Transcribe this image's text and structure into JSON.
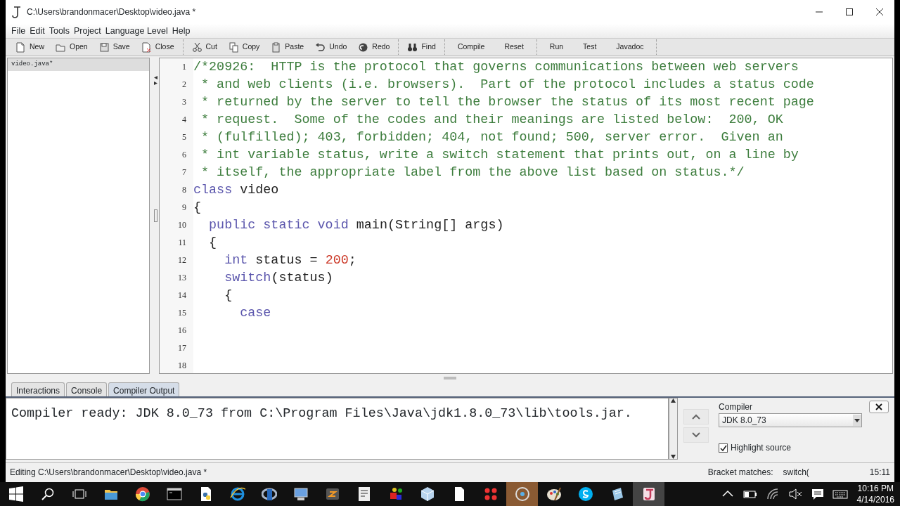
{
  "window": {
    "title": "C:\\Users\\brandonmacer\\Desktop\\video.java *"
  },
  "menu": [
    {
      "label": "File"
    },
    {
      "label": "Edit"
    },
    {
      "label": "Tools"
    },
    {
      "label": "Project"
    },
    {
      "label": "Language Level"
    },
    {
      "label": "Help"
    }
  ],
  "toolbar": [
    [
      {
        "label": "New",
        "kind": "new"
      },
      {
        "label": "Open",
        "kind": "open"
      },
      {
        "label": "Save",
        "kind": "save"
      },
      {
        "label": "Close",
        "kind": "close"
      }
    ],
    [
      {
        "label": "Cut",
        "kind": "cut"
      },
      {
        "label": "Copy",
        "kind": "copy"
      },
      {
        "label": "Paste",
        "kind": "paste"
      },
      {
        "label": "Undo",
        "kind": "undo"
      },
      {
        "label": "Redo",
        "kind": "redo"
      }
    ],
    [
      {
        "label": "Find",
        "kind": "find"
      }
    ],
    [
      {
        "label": "Compile",
        "kind": "text"
      },
      {
        "label": "Reset",
        "kind": "text"
      }
    ],
    [
      {
        "label": "Run",
        "kind": "text"
      },
      {
        "label": "Test",
        "kind": "text"
      },
      {
        "label": "Javadoc",
        "kind": "text"
      }
    ]
  ],
  "documents": [
    {
      "name": "video.java*",
      "selected": true
    }
  ],
  "editor": {
    "lines": [
      {
        "number": "1",
        "tokens": [
          {
            "kind": "comment",
            "text": "/*20926:  HTTP is the protocol that governs communications between web servers"
          }
        ]
      },
      {
        "number": "2",
        "tokens": [
          {
            "kind": "comment",
            "text": " * and web clients (i.e. browsers).  Part of the protocol includes a status code"
          }
        ]
      },
      {
        "number": "3",
        "tokens": [
          {
            "kind": "comment",
            "text": " * returned by the server to tell the browser the status of its most recent page"
          }
        ]
      },
      {
        "number": "4",
        "tokens": [
          {
            "kind": "comment",
            "text": " * request.  Some of the codes and their meanings are listed below:  200, OK"
          }
        ]
      },
      {
        "number": "5",
        "tokens": [
          {
            "kind": "comment",
            "text": " * (fulfilled); 403, forbidden; 404, not found; 500, server error.  Given an"
          }
        ]
      },
      {
        "number": "6",
        "tokens": [
          {
            "kind": "comment",
            "text": " * int variable status, write a switch statement that prints out, on a line by"
          }
        ]
      },
      {
        "number": "7",
        "tokens": [
          {
            "kind": "comment",
            "text": " * itself, the appropriate label from the above list based on status.*/"
          }
        ]
      },
      {
        "number": "8",
        "tokens": [
          {
            "kind": "keyword",
            "text": "class"
          },
          {
            "kind": "plain",
            "text": " video"
          }
        ]
      },
      {
        "number": "9",
        "tokens": [
          {
            "kind": "plain",
            "text": "{"
          }
        ]
      },
      {
        "number": "10",
        "tokens": [
          {
            "kind": "keyword",
            "text": "  public static void"
          },
          {
            "kind": "plain",
            "text": " main(String[] args)"
          }
        ]
      },
      {
        "number": "11",
        "tokens": [
          {
            "kind": "plain",
            "text": "  {"
          }
        ]
      },
      {
        "number": "12",
        "tokens": [
          {
            "kind": "keyword",
            "text": "    int"
          },
          {
            "kind": "plain",
            "text": " status = "
          },
          {
            "kind": "number",
            "text": "200"
          },
          {
            "kind": "plain",
            "text": ";"
          }
        ]
      },
      {
        "number": "13",
        "tokens": [
          {
            "kind": "keyword",
            "text": "    switch"
          },
          {
            "kind": "plain",
            "text": "(status)"
          }
        ]
      },
      {
        "number": "14",
        "tokens": [
          {
            "kind": "plain",
            "text": "    {"
          }
        ]
      },
      {
        "number": "15",
        "tokens": [
          {
            "kind": "keyword",
            "text": "      case"
          }
        ]
      },
      {
        "number": "16"
      },
      {
        "number": "17"
      },
      {
        "number": "18"
      }
    ]
  },
  "bottom_tabs": [
    {
      "label": "Interactions",
      "selected": false
    },
    {
      "label": "Console",
      "selected": false
    },
    {
      "label": "Compiler Output",
      "selected": true
    }
  ],
  "compiler_output": "Compiler ready: JDK 8.0_73 from C:\\Program Files\\Java\\jdk1.8.0_73\\lib\\tools.jar.",
  "compiler_panel": {
    "label": "Compiler",
    "value": "JDK 8.0_73",
    "highlight_source": {
      "label": "Highlight source",
      "checked": true
    }
  },
  "status_bar": {
    "path": "Editing C:\\Users\\brandonmacer\\Desktop\\video.java *",
    "bracket_label": "Bracket matches:",
    "bracket_value": "switch(",
    "position": "15:11"
  },
  "taskbar": {
    "apps": [
      {
        "kind": "folder",
        "active": false,
        "attention": false
      },
      {
        "kind": "chrome",
        "active": false,
        "attention": false
      },
      {
        "kind": "terminal",
        "active": false,
        "attention": false
      },
      {
        "kind": "python",
        "active": false,
        "attention": false
      },
      {
        "kind": "browser",
        "active": false,
        "attention": false
      },
      {
        "kind": "rlang",
        "active": false,
        "attention": false
      },
      {
        "kind": "network",
        "active": false,
        "attention": false
      },
      {
        "kind": "editor",
        "active": false,
        "attention": false
      },
      {
        "kind": "tex",
        "active": false,
        "attention": false
      },
      {
        "kind": "shapes",
        "active": false,
        "attention": false
      },
      {
        "kind": "cube",
        "active": false,
        "attention": false
      },
      {
        "kind": "file",
        "active": false,
        "attention": false
      },
      {
        "kind": "dots",
        "active": false,
        "attention": false
      },
      {
        "kind": "disc",
        "active": false,
        "attention": true
      },
      {
        "kind": "palette",
        "active": false,
        "attention": false
      },
      {
        "kind": "skype",
        "active": false,
        "attention": false
      },
      {
        "kind": "notepad",
        "active": false,
        "attention": false
      },
      {
        "kind": "java",
        "active": true,
        "attention": false
      }
    ],
    "clock": {
      "time": "10:16 PM",
      "date": "4/14/2016"
    }
  }
}
